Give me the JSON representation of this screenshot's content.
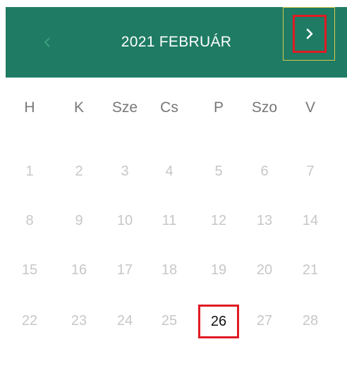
{
  "header": {
    "title": "2021 FEBRUÁR",
    "prev_icon": "chevron-left-icon",
    "next_icon": "chevron-right-icon",
    "background": "#1f7b64"
  },
  "weekdays": [
    "H",
    "K",
    "Sze",
    "Cs",
    "P",
    "Szo",
    "V"
  ],
  "weeks": [
    [
      "1",
      "2",
      "3",
      "4",
      "5",
      "6",
      "7"
    ],
    [
      "8",
      "9",
      "10",
      "11",
      "12",
      "13",
      "14"
    ],
    [
      "15",
      "16",
      "17",
      "18",
      "19",
      "20",
      "21"
    ],
    [
      "22",
      "23",
      "24",
      "25",
      "26",
      "27",
      "28"
    ]
  ],
  "selected_day": "26",
  "colors": {
    "accent": "#1f7b64",
    "highlight_border": "#e01b24",
    "day_text_disabled": "#c7c7c7",
    "weekday_text": "#777777"
  }
}
